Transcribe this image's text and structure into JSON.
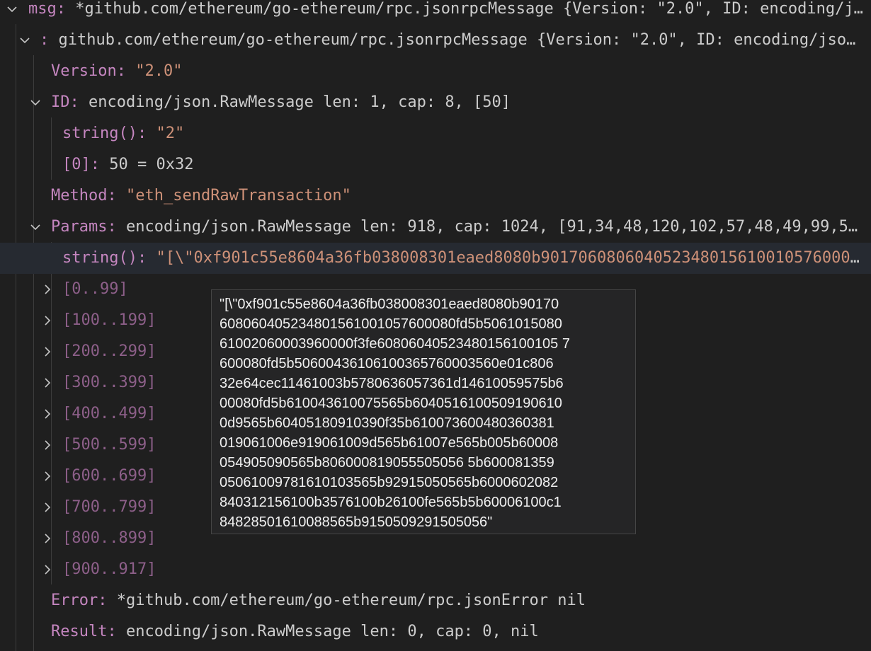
{
  "tree": {
    "msg": {
      "key": "msg",
      "sep": ": ",
      "value": "*github.com/ethereum/go-ethereum/rpc.jsonrpcMessage {Version: \"2.0\", ID: encoding/js…"
    },
    "anon": {
      "key": "",
      "sep": ": ",
      "value": "github.com/ethereum/go-ethereum/rpc.jsonrpcMessage {Version: \"2.0\", ID: encoding/json.…"
    },
    "version": {
      "key": "Version",
      "sep": ": ",
      "value": "\"2.0\""
    },
    "id": {
      "key": "ID",
      "sep": ": ",
      "value": "encoding/json.RawMessage len: 1, cap: 8, [50]"
    },
    "id_string": {
      "key": "string()",
      "sep": ": ",
      "value": "\"2\""
    },
    "id_zero": {
      "key": "[0]",
      "sep": ": ",
      "value": "50 = 0x32"
    },
    "method": {
      "key": "Method",
      "sep": ": ",
      "value": "\"eth_sendRawTransaction\""
    },
    "params": {
      "key": "Params",
      "sep": ": ",
      "value": "encoding/json.RawMessage len: 918, cap: 1024, [91,34,48,120,102,57,48,49,99,53,…"
    },
    "params_string": {
      "key": "string()",
      "sep": ": ",
      "value": "\"[\\\"0xf901c55e8604a36fb038008301eaed8080b90170608060405234801561001057600008…"
    },
    "ranges": [
      "[0..99]",
      "[100..199]",
      "[200..299]",
      "[300..399]",
      "[400..499]",
      "[500..599]",
      "[600..699]",
      "[700..799]",
      "[800..899]",
      "[900..917]"
    ],
    "error": {
      "key": "Error",
      "sep": ": ",
      "value": "*github.com/ethereum/go-ethereum/rpc.jsonError nil"
    },
    "result": {
      "key": "Result",
      "sep": ": ",
      "value": "encoding/json.RawMessage len: 0, cap: 0, nil"
    }
  },
  "tooltip": {
    "lines": [
      "\"[\\\"0xf901c55e8604a36fb038008301eaed8080b90170",
      "608060405234801561001057600080fd5b5061015080",
      "61002060003960000f3fe60806040523480156100105 7",
      "600080fd5b50600436106100365760003560e01c806",
      "32e64cec11461003b5780636057361d14610059575b6",
      "00080fd5b610043610075565b6040516100509190610",
      "0d9565b60405180910390f35b610073600480360381",
      "019061006e919061009d565b61007e565b005b60008",
      "054905090565b806000819055505056 5b600081359",
      "05061009781610103565b92915050565b6000602082",
      "840312156100b3576100b26100fe565b5b60006100c1",
      "84828501610088565b9150509291505056\""
    ]
  },
  "colors": {
    "key": "#c586c0",
    "string": "#ce9178",
    "background": "#1f1f1f",
    "selected_row": "#262a31"
  }
}
